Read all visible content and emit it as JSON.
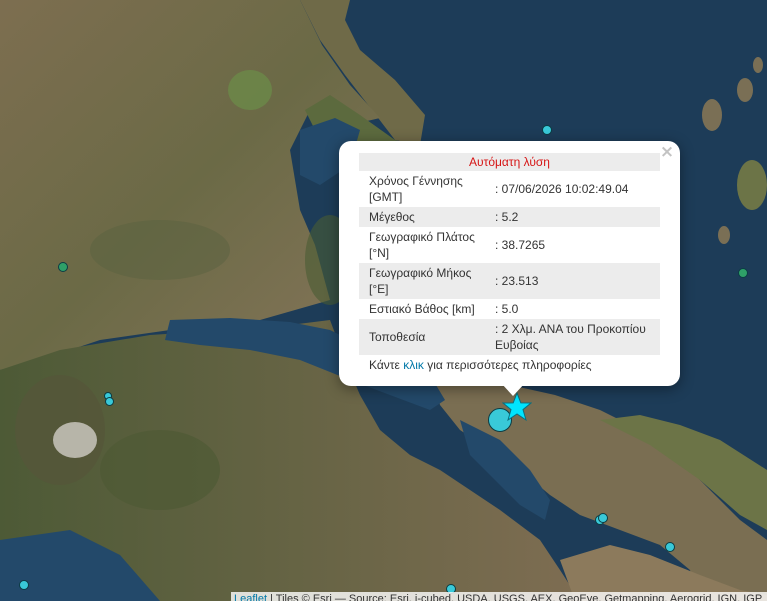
{
  "popup": {
    "status": "Αυτόματη λύση",
    "close_symbol": "×",
    "rows": [
      {
        "label": "Χρόνος Γέννησης [GMT]",
        "value": ": 07/06/2026 10:02:49.04"
      },
      {
        "label": "Μέγεθος",
        "value": ": 5.2"
      },
      {
        "label": "Γεωγραφικό Πλάτος [°N]",
        "value": ": 38.7265"
      },
      {
        "label": "Γεωγραφικό Μήκος [°E]",
        "value": ": 23.513"
      },
      {
        "label": "Εστιακό Βάθος [km]",
        "value": ": 5.0"
      },
      {
        "label": "Τοποθεσία",
        "value": ": 2 Χλμ. ΑΝΑ του Προκοπίου Ευβοίας"
      }
    ],
    "more_prefix": "Κάντε ",
    "more_link": "κλικ",
    "more_suffix": " για περισσότερες πληροφορίες"
  },
  "attribution": {
    "leaflet": "Leaflet",
    "text": " | Tiles © Esri — Source: Esri, i-cubed, USDA, USGS, AEX, GeoEye, Getmapping, Aerogrid, IGN, IGP"
  },
  "colors": {
    "sea": "#1d3c58",
    "marker_cyan": "#39c9d8",
    "marker_green": "#2fa068",
    "status_red": "#d61515",
    "link_blue": "#0078a8"
  }
}
